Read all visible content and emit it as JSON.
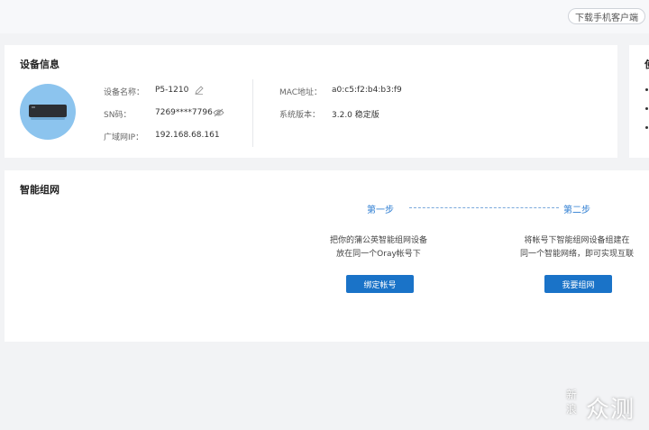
{
  "header": {
    "download_label": "下载手机客户端"
  },
  "device_info": {
    "title": "设备信息",
    "name_label": "设备名称：",
    "name_value": "P5-1210",
    "sn_label": "SN码：",
    "sn_value": "7269****7796",
    "wan_label": "广域网IP：",
    "wan_value": "192.168.68.161",
    "mac_label": "MAC地址：",
    "mac_value": "a0:c5:f2:b4:b3:f9",
    "version_label": "系统版本：",
    "version_value": "3.2.0 稳定版"
  },
  "side_card": {
    "title_partial": "使"
  },
  "smart_network": {
    "title": "智能组网",
    "step1": {
      "label": "第一步",
      "desc_line1": "把你的蒲公英智能组网设备",
      "desc_line2": "放在同一个Oray帐号下",
      "button": "绑定帐号"
    },
    "step2": {
      "label": "第二步",
      "desc_line1": "将帐号下智能组网设备组建在",
      "desc_line2": "同一个智能网络，即可实现互联",
      "button": "我要组网"
    }
  },
  "watermark": {
    "small": "新浪",
    "big": "众测"
  },
  "colors": {
    "accent": "#1a73c8",
    "step_text": "#2d7dd2",
    "avatar_bg": "#8cc4ee"
  }
}
